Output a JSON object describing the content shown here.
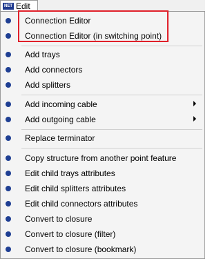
{
  "menu": {
    "tab_label": "Edit",
    "tab_icon_text": "NET",
    "items": [
      {
        "label": "Connection Editor"
      },
      {
        "label": "Connection Editor (in switching point)"
      },
      {
        "label": "Add trays"
      },
      {
        "label": "Add connectors"
      },
      {
        "label": "Add splitters"
      },
      {
        "label": "Add incoming cable"
      },
      {
        "label": "Add outgoing cable"
      },
      {
        "label": "Replace terminator"
      },
      {
        "label": "Copy structure from another point feature"
      },
      {
        "label": "Edit child trays attributes"
      },
      {
        "label": "Edit child splitters attributes"
      },
      {
        "label": "Edit child connectors attributes"
      },
      {
        "label": "Convert to closure"
      },
      {
        "label": "Convert to closure (filter)"
      },
      {
        "label": "Convert to closure (bookmark)"
      }
    ]
  },
  "colors": {
    "bullet": "#1f3f93",
    "highlight": "#e0202a"
  }
}
